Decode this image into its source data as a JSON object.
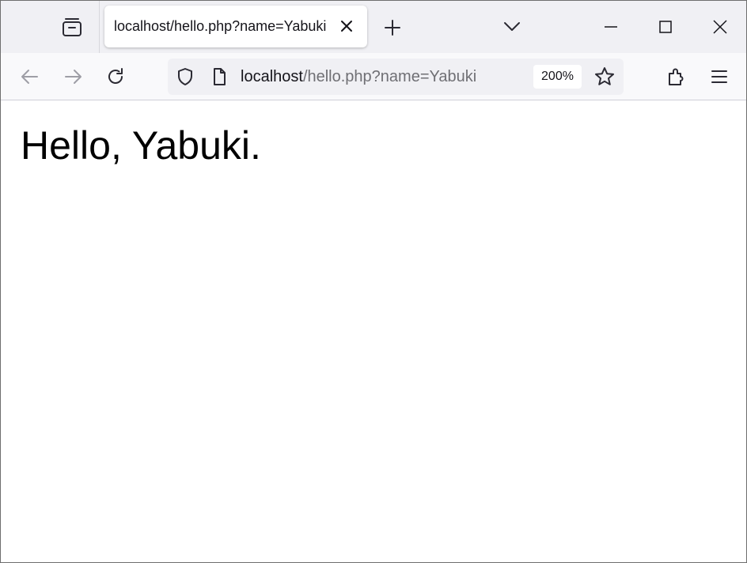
{
  "tab": {
    "title": "localhost/hello.php?name=Yabuki"
  },
  "urlbar": {
    "host": "localhost",
    "path": "/hello.php?name=Yabuki",
    "zoom": "200%"
  },
  "page": {
    "greeting": "Hello, Yabuki."
  },
  "icons": {
    "overview": "firefox-view-icon",
    "tab_close": "close-icon",
    "new_tab": "plus-icon",
    "tab_list": "chevron-down-icon",
    "back": "arrow-left-icon",
    "forward": "arrow-right-icon",
    "reload": "reload-icon",
    "tracking_protection": "shield-icon",
    "page_info": "page-icon",
    "bookmark": "star-icon",
    "extensions": "puzzle-icon",
    "menu": "hamburger-icon"
  },
  "colors": {
    "tabstrip_bg": "#f0f0f4",
    "toolbar_bg": "#f9f9fb",
    "urlbar_bg": "#f0f0f4",
    "url_path": "#6f6f74",
    "disabled_icon": "#9e9ea6"
  }
}
